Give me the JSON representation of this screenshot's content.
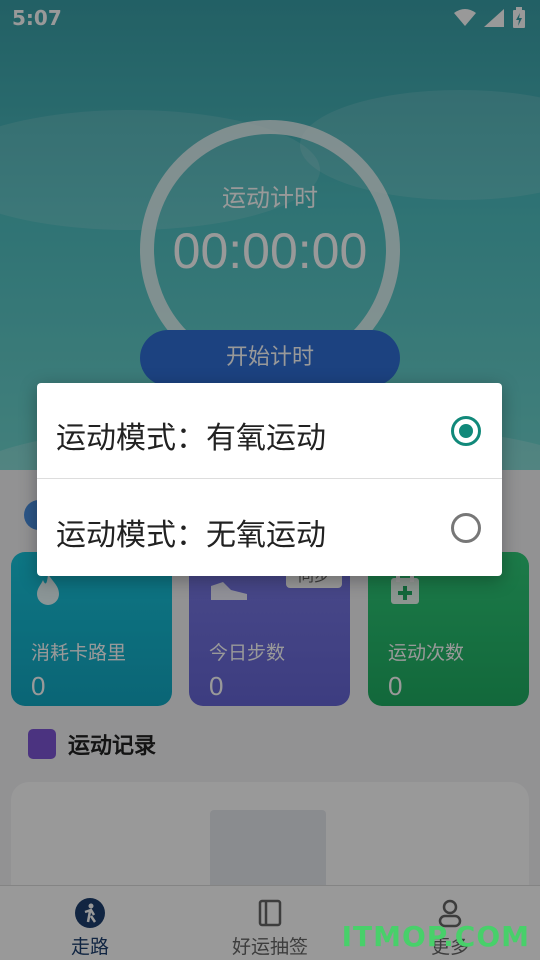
{
  "status": {
    "time": "5:07"
  },
  "timer": {
    "title": "运动计时",
    "value": "00:00:00",
    "start_label": "开始计时"
  },
  "cards": [
    {
      "label": "消耗卡路里",
      "value": "0",
      "icon": "flame-icon"
    },
    {
      "label": "今日步数",
      "value": "0",
      "icon": "shoe-icon",
      "badge": "同步"
    },
    {
      "label": "运动次数",
      "value": "0",
      "icon": "calendar-add-icon"
    }
  ],
  "records": {
    "title": "运动记录"
  },
  "tabs": [
    {
      "label": "走路",
      "icon": "walk-icon",
      "active": true
    },
    {
      "label": "好运抽签",
      "icon": "notebook-icon",
      "active": false
    },
    {
      "label": "更多",
      "icon": "person-icon",
      "active": false
    }
  ],
  "dialog": {
    "options": [
      {
        "label": "运动模式：有氧运动",
        "selected": true
      },
      {
        "label": "运动模式：无氧运动",
        "selected": false
      }
    ]
  },
  "watermark": "ITMOP.COM",
  "colors": {
    "accent": "#11897a",
    "primary_blue": "#2f6fd6",
    "card_cyan": "#12a9c4",
    "card_purple": "#6666d6",
    "card_green": "#1fae63"
  }
}
